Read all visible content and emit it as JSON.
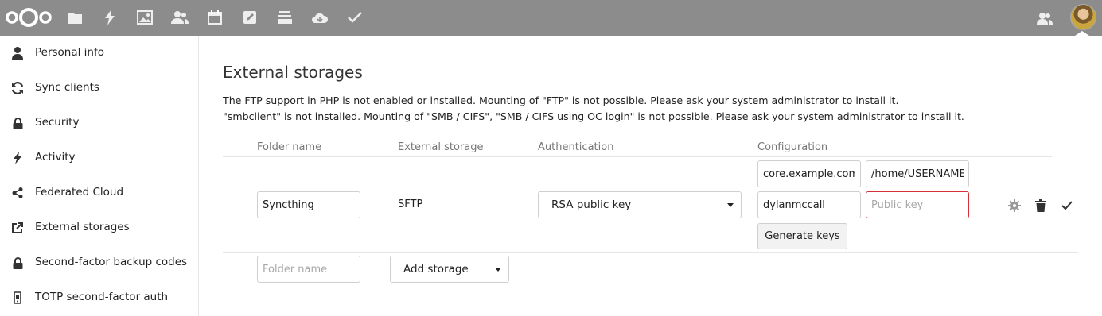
{
  "topbar": {
    "logo_icon": "nextcloud-logo-icon",
    "apps": [
      {
        "icon": "files-icon"
      },
      {
        "icon": "activity-icon"
      },
      {
        "icon": "gallery-icon"
      },
      {
        "icon": "contacts-icon"
      },
      {
        "icon": "calendar-icon"
      },
      {
        "icon": "notes-icon"
      },
      {
        "icon": "deck-icon"
      },
      {
        "icon": "cloud-icon"
      },
      {
        "icon": "tasks-icon"
      }
    ],
    "right_icons": [
      "contacts-menu-icon",
      "user-avatar"
    ]
  },
  "sidebar": {
    "items": [
      {
        "label": "Personal info",
        "icon": "user-icon"
      },
      {
        "label": "Sync clients",
        "icon": "sync-icon"
      },
      {
        "label": "Security",
        "icon": "lock-icon"
      },
      {
        "label": "Activity",
        "icon": "activity-icon"
      },
      {
        "label": "Federated Cloud",
        "icon": "share-icon"
      },
      {
        "label": "External storages",
        "icon": "external-link-icon"
      },
      {
        "label": "Second-factor backup codes",
        "icon": "lock-icon"
      },
      {
        "label": "TOTP second-factor auth",
        "icon": "phone-icon"
      }
    ]
  },
  "main": {
    "title": "External storages",
    "warnings": [
      "The FTP support in PHP is not enabled or installed. Mounting of \"FTP\" is not possible. Please ask your system administrator to install it.",
      "\"smbclient\" is not installed. Mounting of \"SMB / CIFS\", \"SMB / CIFS using OC login\" is not possible. Please ask your system administrator to install it."
    ],
    "table": {
      "headers": {
        "folder_name": "Folder name",
        "external_storage": "External storage",
        "authentication": "Authentication",
        "configuration": "Configuration"
      },
      "row": {
        "folder_name": "Syncthing",
        "storage": "SFTP",
        "authentication": "RSA public key",
        "config": {
          "host": "core.example.com",
          "root": "/home/USERNAME/",
          "user": "dylanmccall",
          "public_key_placeholder": "Public key",
          "generate_keys_label": "Generate keys"
        }
      },
      "new_row": {
        "folder_name_placeholder": "Folder name",
        "add_storage_label": "Add storage"
      }
    }
  },
  "colors": {
    "topbar": "#8c8c8c",
    "error_border": "#d62f3a",
    "divider": "#e6e6e6"
  }
}
